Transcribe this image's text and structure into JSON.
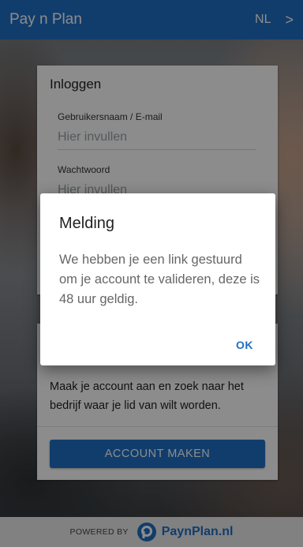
{
  "app_bar": {
    "title": "Pay n Plan",
    "language": "NL",
    "chevron": ">"
  },
  "login_card": {
    "heading": "Inloggen",
    "username_label": "Gebruikersnaam / E-mail",
    "username_placeholder": "Hier invullen",
    "password_label": "Wachtwoord",
    "password_placeholder": "Hier invullen"
  },
  "register_card": {
    "text": "Maak je account aan en zoek naar het bedrijf waar je lid van wilt worden.",
    "button_label": "ACCOUNT MAKEN"
  },
  "footer": {
    "powered_by": "POWERED BY",
    "brand": "PaynPlan.nl"
  },
  "dialog": {
    "title": "Melding",
    "message": "We hebben je een link gestuurd om je account te valideren, deze is 48 uur geldig.",
    "ok_label": "OK"
  },
  "colors": {
    "primary": "#1f6fc5",
    "footer_bg": "#ececec"
  },
  "icons": {
    "chevron": "chevron-right-icon",
    "logo": "paynplan-logo-icon"
  }
}
